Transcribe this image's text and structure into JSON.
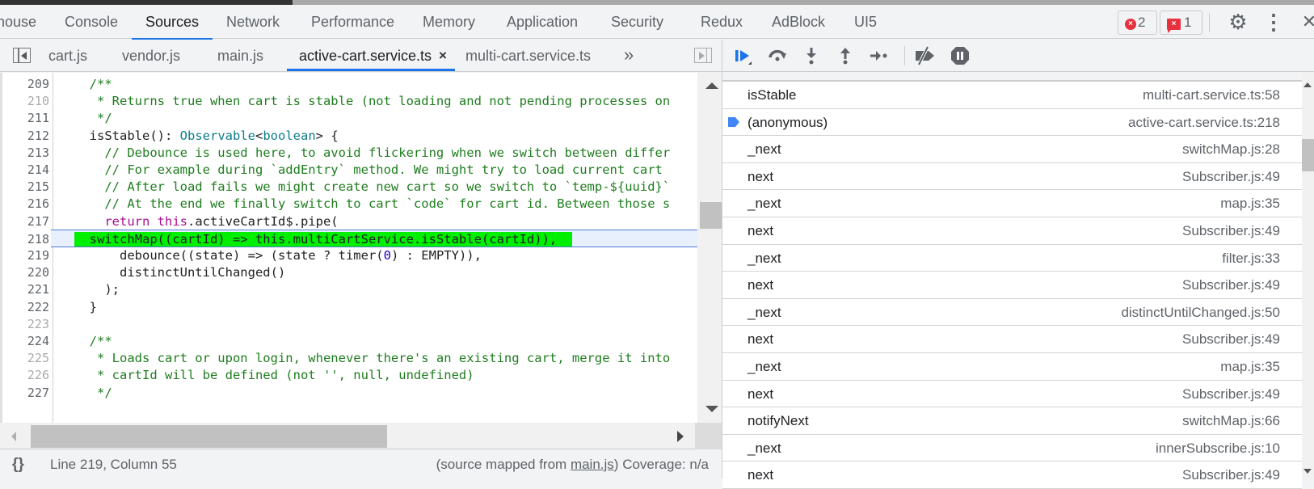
{
  "main_tabs": [
    {
      "label": "house"
    },
    {
      "label": "Console"
    },
    {
      "label": "Sources",
      "active": true
    },
    {
      "label": "Network"
    },
    {
      "label": "Performance"
    },
    {
      "label": "Memory"
    },
    {
      "label": "Application"
    },
    {
      "label": "Security"
    },
    {
      "label": "Redux"
    },
    {
      "label": "AdBlock"
    },
    {
      "label": "UI5"
    }
  ],
  "badges": {
    "errors_count": "2",
    "issues_count": "1",
    "error_glyph": "×"
  },
  "icons": {
    "settings": "⚙",
    "more": "⋮",
    "close": "✕",
    "more_tabs": "»",
    "close_tab": "×",
    "pretty_print": "{}"
  },
  "file_tabs": [
    {
      "label": "cart.js"
    },
    {
      "label": "vendor.js"
    },
    {
      "label": "main.js"
    },
    {
      "label": "active-cart.service.ts",
      "active": true
    },
    {
      "label": "multi-cart.service.ts"
    }
  ],
  "code": {
    "execution_line": 218,
    "lines": [
      {
        "n": "209",
        "text": "  /**"
      },
      {
        "n": "210",
        "text": "   * Returns true when cart is stable (not loading and not pending processes on"
      },
      {
        "n": "211",
        "text": "   */"
      },
      {
        "n": "212",
        "text": "  isStable(): Observable<boolean> {"
      },
      {
        "n": "213",
        "text": "    // Debounce is used here, to avoid flickering when we switch between differ"
      },
      {
        "n": "214",
        "text": "    // For example during `addEntry` method. We might try to load current cart"
      },
      {
        "n": "215",
        "text": "    // After load fails we might create new cart so we switch to `temp-${uuid}`"
      },
      {
        "n": "216",
        "text": "    // At the end we finally switch to cart `code` for cart id. Between those s"
      },
      {
        "n": "217",
        "text": "    return this.activeCartId$.pipe("
      },
      {
        "n": "218",
        "text": "      switchMap((cartId) => this.multiCartService.isStable(cartId)),"
      },
      {
        "n": "219",
        "text": "      debounce((state) => (state ? timer(0) : EMPTY)),"
      },
      {
        "n": "220",
        "text": "      distinctUntilChanged()"
      },
      {
        "n": "221",
        "text": "    );"
      },
      {
        "n": "222",
        "text": "  }"
      },
      {
        "n": "223",
        "text": ""
      },
      {
        "n": "224",
        "text": "  /**"
      },
      {
        "n": "225",
        "text": "   * Loads cart or upon login, whenever there's an existing cart, merge it into"
      },
      {
        "n": "226",
        "text": "   * cartId will be defined (not '', null, undefined)"
      },
      {
        "n": "227",
        "text": "   */"
      }
    ]
  },
  "status": {
    "position": "Line 219, Column 55",
    "source_prefix": "(source mapped from ",
    "source_link": "main.js",
    "source_suffix": ")",
    "coverage": "Coverage: n/a"
  },
  "call_stack": [
    {
      "name": "isStable",
      "location": "multi-cart.service.ts:58"
    },
    {
      "name": "(anonymous)",
      "location": "active-cart.service.ts:218",
      "current": true
    },
    {
      "name": "_next",
      "location": "switchMap.js:28"
    },
    {
      "name": "next",
      "location": "Subscriber.js:49"
    },
    {
      "name": "_next",
      "location": "map.js:35"
    },
    {
      "name": "next",
      "location": "Subscriber.js:49"
    },
    {
      "name": "_next",
      "location": "filter.js:33"
    },
    {
      "name": "next",
      "location": "Subscriber.js:49"
    },
    {
      "name": "_next",
      "location": "distinctUntilChanged.js:50"
    },
    {
      "name": "next",
      "location": "Subscriber.js:49"
    },
    {
      "name": "_next",
      "location": "map.js:35"
    },
    {
      "name": "next",
      "location": "Subscriber.js:49"
    },
    {
      "name": "notifyNext",
      "location": "switchMap.js:66"
    },
    {
      "name": "_next",
      "location": "innerSubscribe.js:10"
    },
    {
      "name": "next",
      "location": "Subscriber.js:49"
    }
  ],
  "colors": {
    "accent": "#1a73e8",
    "exec_highlight": "#00ee00",
    "error_red": "#e8313e"
  }
}
